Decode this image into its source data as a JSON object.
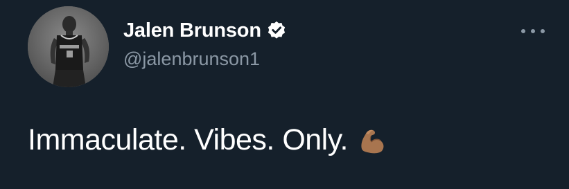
{
  "tweet": {
    "display_name": "Jalen Brunson",
    "handle": "@jalenbrunson1",
    "text": "Immaculate. Vibes. Only.",
    "emoji_icon": "flexed-biceps-icon",
    "verified_icon": "verified-badge-icon",
    "more_icon": "more-options-icon"
  },
  "colors": {
    "background": "#15202b",
    "name": "#ffffff",
    "handle": "#8b98a5",
    "text": "#ffffff"
  }
}
